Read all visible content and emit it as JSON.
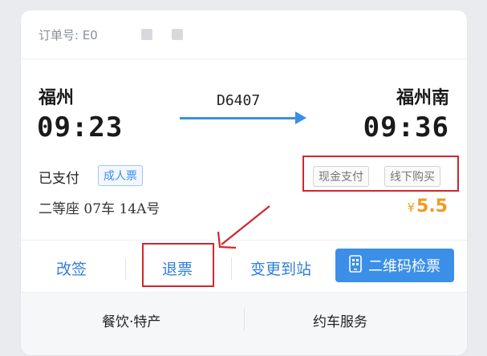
{
  "order": {
    "label": "订单号: E0"
  },
  "trip": {
    "from_station": "福州",
    "to_station": "福州南",
    "depart_time": "09:23",
    "arrive_time": "09:36",
    "train_no": "D6407"
  },
  "ticket": {
    "status": "已支付",
    "type_badge": "成人票",
    "seat": "二等座 07车 14A号",
    "payment_tags": [
      "现金支付",
      "线下购买"
    ],
    "price_symbol": "¥",
    "price_value": "5.5"
  },
  "actions": {
    "change": "改签",
    "refund": "退票",
    "change_station": "变更到站",
    "qr_check": "二维码检票"
  },
  "services": {
    "catering": "餐饮·特产",
    "car": "约车服务"
  },
  "colors": {
    "accent": "#3b8fe8",
    "annotation_red": "#d1262e",
    "price": "#f29a1f"
  }
}
